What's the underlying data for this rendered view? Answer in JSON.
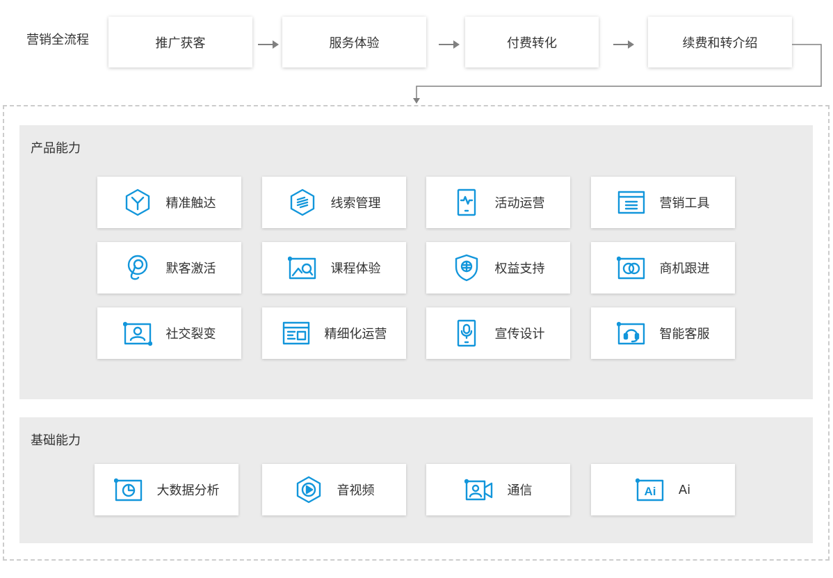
{
  "flow": {
    "label": "营销全流程",
    "steps": [
      "推广获客",
      "服务体验",
      "付费转化",
      "续费和转介绍"
    ]
  },
  "product": {
    "title": "产品能力",
    "items": [
      {
        "label": "精准触达",
        "icon": "hexagon-fork-icon"
      },
      {
        "label": "线索管理",
        "icon": "hexagon-link-icon"
      },
      {
        "label": "活动运营",
        "icon": "phone-pulse-icon"
      },
      {
        "label": "营销工具",
        "icon": "window-list-icon"
      },
      {
        "label": "默客激活",
        "icon": "pin-swirl-icon"
      },
      {
        "label": "课程体验",
        "icon": "image-search-icon"
      },
      {
        "label": "权益支持",
        "icon": "shield-icon"
      },
      {
        "label": "商机跟进",
        "icon": "rings-icon"
      },
      {
        "label": "社交裂变",
        "icon": "user-frame-icon"
      },
      {
        "label": "精细化运营",
        "icon": "browser-form-icon"
      },
      {
        "label": "宣传设计",
        "icon": "phone-mic-icon"
      },
      {
        "label": "智能客服",
        "icon": "headset-icon"
      }
    ]
  },
  "base": {
    "title": "基础能力",
    "items": [
      {
        "label": "大数据分析",
        "icon": "pie-chart-icon"
      },
      {
        "label": "音视频",
        "icon": "hexagon-play-icon"
      },
      {
        "label": "通信",
        "icon": "video-call-icon"
      },
      {
        "label": "Ai",
        "icon": "ai-icon",
        "badge": "Ai"
      }
    ]
  },
  "colors": {
    "accent": "#1296db",
    "panel": "#ebebeb",
    "arrow": "#808080"
  }
}
